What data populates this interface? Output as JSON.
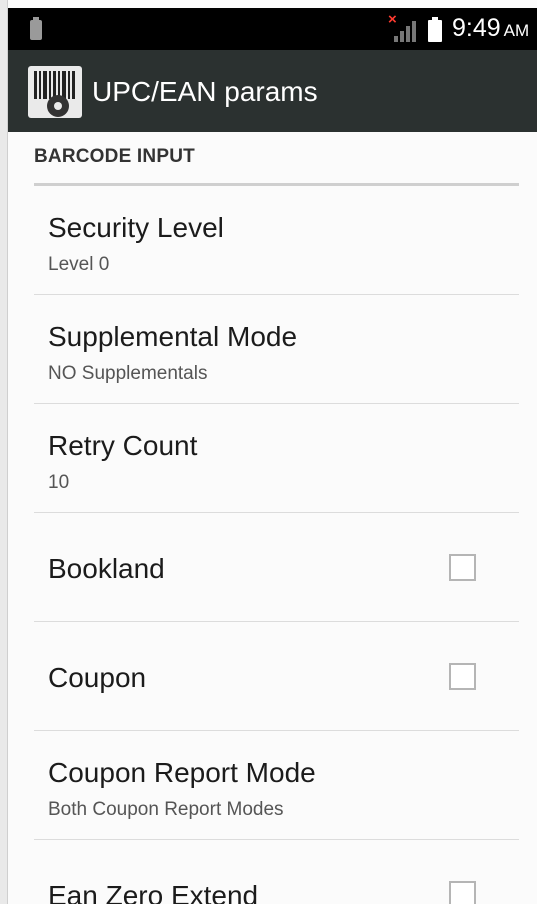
{
  "status_bar": {
    "time": "9:49",
    "ampm": "AM"
  },
  "action_bar": {
    "title": "UPC/EAN params"
  },
  "category": {
    "label": "BARCODE INPUT"
  },
  "items": [
    {
      "title": "Security Level",
      "summary": "Level 0"
    },
    {
      "title": "Supplemental Mode",
      "summary": "NO Supplementals"
    },
    {
      "title": "Retry Count",
      "summary": "10"
    },
    {
      "title": "Bookland",
      "checked": false
    },
    {
      "title": "Coupon",
      "checked": false
    },
    {
      "title": "Coupon Report Mode",
      "summary": "Both Coupon Report Modes"
    },
    {
      "title": "Ean Zero Extend",
      "checked": false
    }
  ],
  "colors": {
    "status_bar": "#000000",
    "action_bar": "#2b3130",
    "background": "#fbfbfb"
  }
}
